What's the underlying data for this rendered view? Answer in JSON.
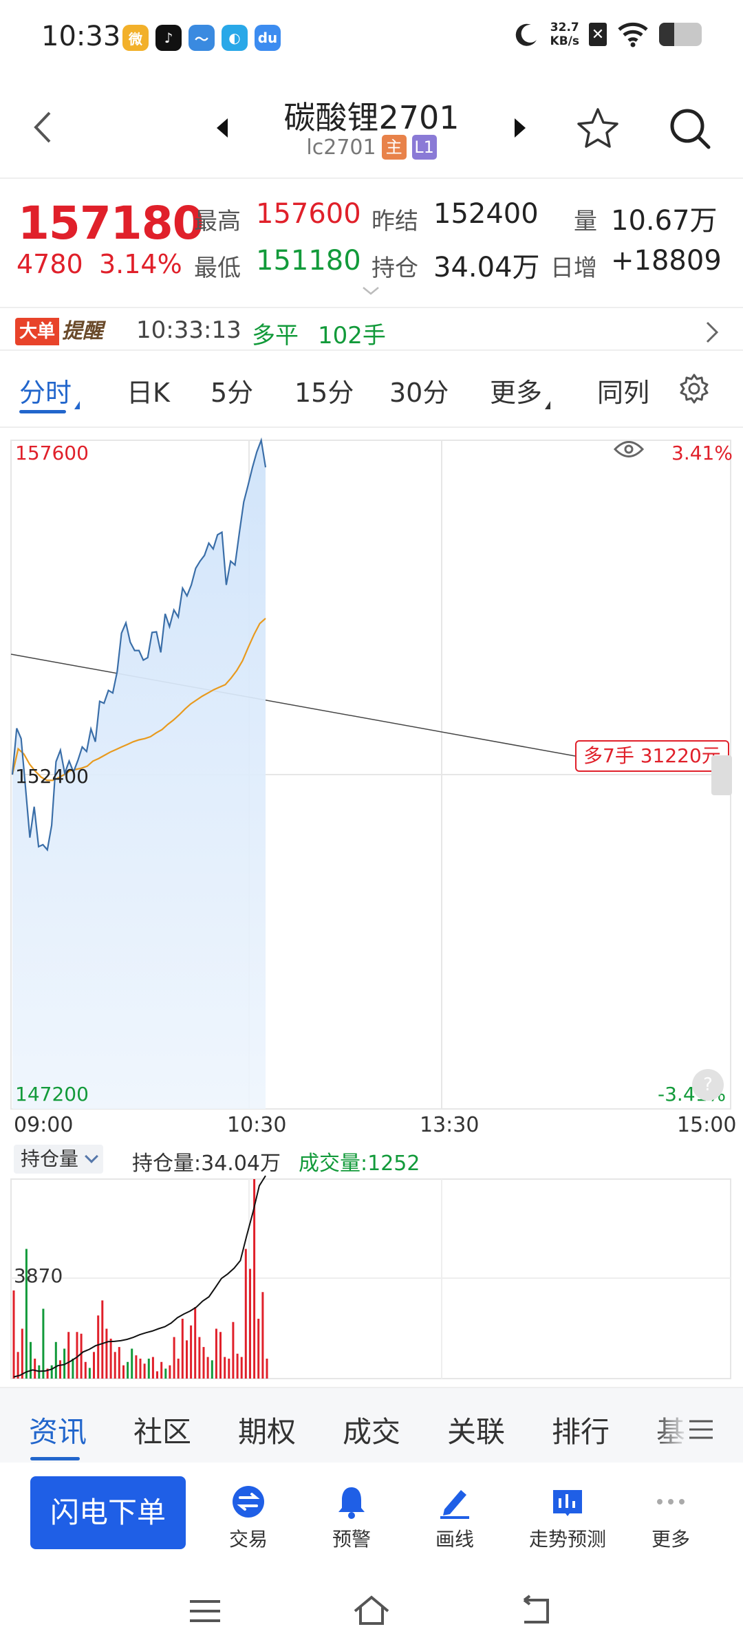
{
  "status_bar": {
    "time": "10:33",
    "apps": [
      {
        "name": "weibo-icon",
        "glyph": "微",
        "color": "#f2b02a"
      },
      {
        "name": "tiktok-icon",
        "glyph": "♪",
        "color": "#111111"
      },
      {
        "name": "stock-app-icon",
        "glyph": "〜",
        "color": "#3a8ae0"
      },
      {
        "name": "files-app-icon",
        "glyph": "◐",
        "color": "#29a8e8"
      },
      {
        "name": "baidu-disk-icon",
        "glyph": "du",
        "color": "#3c8cf0"
      }
    ],
    "speed_value": "32.7",
    "speed_unit": "KB/s",
    "sim_box": "✕"
  },
  "header": {
    "title": "碳酸锂2701",
    "code": "lc2701",
    "tag_main": "主",
    "tag_level": "L1"
  },
  "quote": {
    "price": "157180",
    "change": "4780",
    "change_pct": "3.14%",
    "high_label": "最高",
    "high_value": "157600",
    "low_label": "最低",
    "low_value": "151180",
    "prev_settle_label": "昨结",
    "prev_settle_value": "152400",
    "open_interest_label": "持仓",
    "open_interest_value": "34.04万",
    "volume_label": "量",
    "volume_value": "10.67万",
    "daily_inc_label": "日增",
    "daily_inc_value": "+18809"
  },
  "alert": {
    "badge_1": "大单",
    "badge_2": "提醒",
    "time": "10:33:13",
    "action": "多平",
    "lots": "102手"
  },
  "tabs": [
    {
      "label": "分时",
      "active": true,
      "caret": true
    },
    {
      "label": "日K",
      "active": false,
      "caret": false
    },
    {
      "label": "5分",
      "active": false,
      "caret": false
    },
    {
      "label": "15分",
      "active": false,
      "caret": false
    },
    {
      "label": "30分",
      "active": false,
      "caret": false
    },
    {
      "label": "更多",
      "active": false,
      "caret": true
    },
    {
      "label": "同列",
      "active": false,
      "caret": false
    }
  ],
  "chart": {
    "y_top": "157600",
    "y_mid": "152400",
    "y_bottom": "147200",
    "pct_top": "3.41%",
    "pct_bottom": "-3.41%",
    "x_labels": [
      "09:00",
      "10:30",
      "13:30",
      "15:00"
    ],
    "position_tag": "多7手  31220元",
    "help": "?"
  },
  "chart_data": {
    "type": "line",
    "xlabel": "",
    "ylabel": "",
    "ylim": [
      147200,
      157600
    ],
    "reference": 152400,
    "x_range": [
      "09:00",
      "15:00"
    ],
    "series": [
      {
        "values": [
          152400,
          153120,
          152960,
          152210,
          151420,
          151900,
          151280,
          151310,
          151230,
          151610,
          152600,
          152780,
          152420,
          152610,
          152440,
          152620,
          152830,
          152760,
          153110,
          152910,
          153540,
          153510,
          153710,
          153670,
          154000,
          154600,
          154760,
          154460,
          154330,
          154330,
          154180,
          154220,
          154610,
          154620,
          154300,
          154900,
          154700,
          154960,
          154850,
          155300,
          155180,
          155350,
          155610,
          155720,
          155810,
          156000,
          155910,
          156130,
          156170,
          155350,
          155720,
          155660,
          156160,
          156640,
          156900,
          157180,
          157420,
          157600,
          157180
        ]
      },
      {
        "values": [
          152400,
          152800,
          152720,
          152560,
          152450,
          152360,
          152310,
          152310,
          152350,
          152400,
          152460,
          152480,
          152500,
          152530,
          152610,
          152650,
          152700,
          152750,
          152790,
          152830,
          152870,
          152910,
          152940,
          152960,
          152990,
          153050,
          153100,
          153180,
          153250,
          153330,
          153420,
          153500,
          153560,
          153620,
          153670,
          153720,
          153760,
          153800,
          153900,
          154020,
          154170,
          154380,
          154580,
          154750,
          154830
        ]
      }
    ],
    "volume": {
      "max_label": "3870",
      "open_interest": "34.04万",
      "last_volume": "1252",
      "bars": [
        [
          2650,
          "#e0202a"
        ],
        [
          800,
          "#e0202a"
        ],
        [
          1500,
          "#e0202a"
        ],
        [
          3900,
          "#129a3a"
        ],
        [
          1100,
          "#129a3a"
        ],
        [
          600,
          "#e0202a"
        ],
        [
          400,
          "#129a3a"
        ],
        [
          2100,
          "#129a3a"
        ],
        [
          300,
          "#e0202a"
        ],
        [
          400,
          "#129a3a"
        ],
        [
          1100,
          "#129a3a"
        ],
        [
          550,
          "#e0202a"
        ],
        [
          900,
          "#129a3a"
        ],
        [
          1400,
          "#e0202a"
        ],
        [
          600,
          "#129a3a"
        ],
        [
          1400,
          "#e0202a"
        ],
        [
          1350,
          "#e0202a"
        ],
        [
          500,
          "#e0202a"
        ],
        [
          320,
          "#129a3a"
        ],
        [
          800,
          "#e0202a"
        ],
        [
          1900,
          "#e0202a"
        ],
        [
          2350,
          "#e0202a"
        ],
        [
          1500,
          "#e0202a"
        ],
        [
          1200,
          "#e0202a"
        ],
        [
          800,
          "#e0202a"
        ],
        [
          950,
          "#e0202a"
        ],
        [
          400,
          "#e0202a"
        ],
        [
          500,
          "#129a3a"
        ],
        [
          900,
          "#129a3a"
        ],
        [
          700,
          "#e0202a"
        ],
        [
          600,
          "#e0202a"
        ],
        [
          450,
          "#e0202a"
        ],
        [
          600,
          "#129a3a"
        ],
        [
          650,
          "#e0202a"
        ],
        [
          220,
          "#e0202a"
        ],
        [
          500,
          "#e0202a"
        ],
        [
          300,
          "#129a3a"
        ],
        [
          400,
          "#e0202a"
        ],
        [
          1250,
          "#e0202a"
        ],
        [
          600,
          "#e0202a"
        ],
        [
          1800,
          "#e0202a"
        ],
        [
          1150,
          "#e0202a"
        ],
        [
          1600,
          "#e0202a"
        ],
        [
          2150,
          "#e0202a"
        ],
        [
          1250,
          "#e0202a"
        ],
        [
          950,
          "#e0202a"
        ],
        [
          650,
          "#e0202a"
        ],
        [
          550,
          "#129a3a"
        ],
        [
          1500,
          "#e0202a"
        ],
        [
          1400,
          "#e0202a"
        ],
        [
          650,
          "#e0202a"
        ],
        [
          600,
          "#e0202a"
        ],
        [
          1700,
          "#e0202a"
        ],
        [
          750,
          "#e0202a"
        ],
        [
          650,
          "#e0202a"
        ],
        [
          3900,
          "#e0202a"
        ],
        [
          3300,
          "#e0202a"
        ],
        [
          6000,
          "#e0202a"
        ],
        [
          1800,
          "#e0202a"
        ],
        [
          2600,
          "#e0202a"
        ],
        [
          600,
          "#e0202a"
        ]
      ],
      "oi_line": [
        50,
        100,
        200,
        260,
        220,
        230,
        280,
        390,
        420,
        520,
        640,
        800,
        880,
        990,
        1050,
        1110,
        1120,
        1140,
        1180,
        1240,
        1320,
        1380,
        1430,
        1500,
        1560,
        1670,
        1830,
        1940,
        2030,
        2150,
        2330,
        2460,
        2730,
        3010,
        3150,
        3320,
        3550,
        4300,
        5000,
        5800,
        6100
      ]
    }
  },
  "sub_chart": {
    "selector": "持仓量",
    "oi_text": "持仓量:34.04万",
    "vol_text": "成交量:1252"
  },
  "bottom_tabs": [
    {
      "label": "资讯",
      "active": true
    },
    {
      "label": "社区",
      "active": false
    },
    {
      "label": "期权",
      "active": false
    },
    {
      "label": "成交",
      "active": false
    },
    {
      "label": "关联",
      "active": false
    },
    {
      "label": "排行",
      "active": false
    },
    {
      "label": "基",
      "active": false
    }
  ],
  "actions": {
    "flash_order": "闪电下单",
    "trade": "交易",
    "alert": "预警",
    "draw": "画线",
    "forecast": "走势预测",
    "more": "更多"
  },
  "colors": {
    "up": "#e0202a",
    "down": "#129a3a",
    "accent": "#2266cc",
    "price_line": "#3a6ea8",
    "avg_line": "#e89a1e",
    "area_fill": "#dbeafb"
  }
}
